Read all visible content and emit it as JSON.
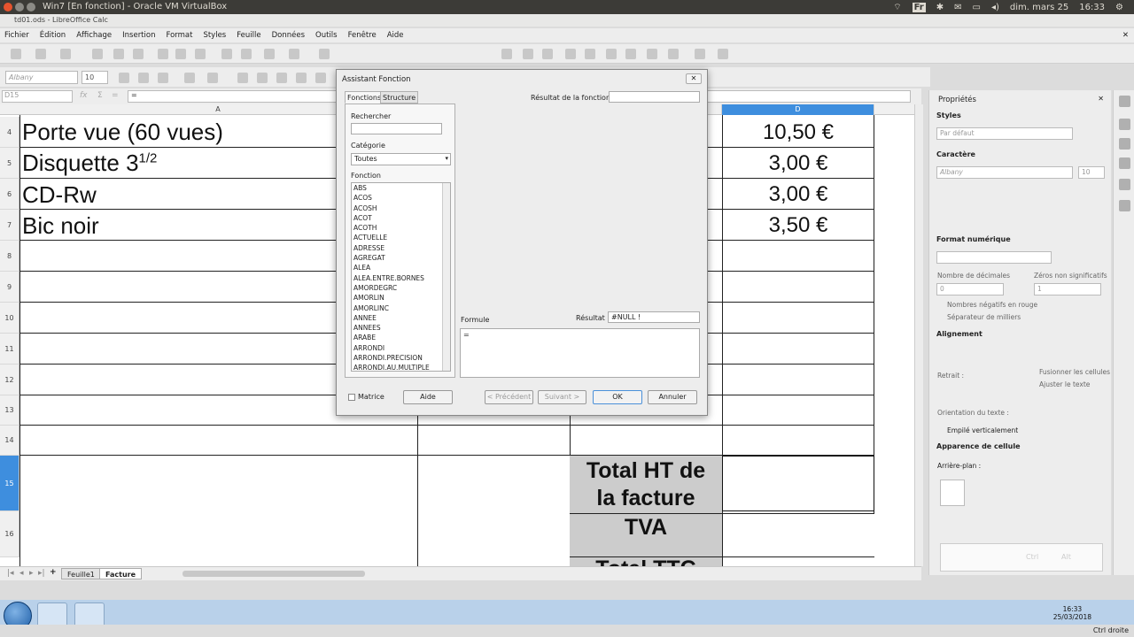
{
  "os": {
    "title": "Win7 [En fonction] - Oracle VM VirtualBox",
    "lang": "Fr",
    "datetime": "dim. mars 25",
    "time": "16:33"
  },
  "app": {
    "title": "td01.ods - LibreOffice Calc"
  },
  "menu": [
    "Fichier",
    "Édition",
    "Affichage",
    "Insertion",
    "Format",
    "Styles",
    "Feuille",
    "Données",
    "Outils",
    "Fenêtre",
    "Aide"
  ],
  "toolbar": {
    "font_name": "Albany",
    "font_size": "10"
  },
  "formula_bar": {
    "name_box": "D15",
    "fx": "fx",
    "sum": "Σ",
    "eq": "=",
    "content": "="
  },
  "columns": [
    {
      "label": "A"
    },
    {
      "label": "D"
    }
  ],
  "rows": {
    "labels": [
      "4",
      "5",
      "6",
      "7",
      "8",
      "9",
      "10",
      "11",
      "12",
      "13",
      "14",
      "15",
      "16"
    ]
  },
  "cells": {
    "a4": "Porte vue (60 vues)",
    "a5": "Disquette 3",
    "a5_sup": "1/2",
    "a6": "CD-Rw",
    "a7": "Bic noir",
    "d4": "10,50 €",
    "d5": "3,00 €",
    "d6": "3,00 €",
    "d7": "3,50 €",
    "c15_line1": "Total HT de",
    "c15_line2": "la facture",
    "c16": "TVA",
    "c17": "Total TTC"
  },
  "sheets": {
    "tabs": [
      "Feuille1",
      "Facture"
    ],
    "active": "Facture",
    "add": "+"
  },
  "dialog": {
    "title": "Assistant Fonction",
    "close": "✕",
    "tabs": [
      "Fonctions",
      "Structure"
    ],
    "search_label": "Rechercher",
    "search_value": "",
    "category_label": "Catégorie",
    "category_value": "Toutes",
    "function_label": "Fonction",
    "functions": [
      "ABS",
      "ACOS",
      "ACOSH",
      "ACOT",
      "ACOTH",
      "ACTUELLE",
      "ADRESSE",
      "AGREGAT",
      "ALEA",
      "ALEA.ENTRE.BORNES",
      "AMORDEGRC",
      "AMORLIN",
      "AMORLINC",
      "ANNEE",
      "ANNEES",
      "ARABE",
      "ARRONDI",
      "ARRONDI.PRECISION",
      "ARRONDI.AU.MULTIPLE"
    ],
    "result_fn_label": "Résultat de la fonction",
    "result_fn_value": "",
    "formula_label": "Formule",
    "result_label": "Résultat",
    "result_value": "#NULL !",
    "formula_value": "=",
    "matrix_label": "Matrice",
    "help": "Aide",
    "prev": "< Précédent",
    "next": "Suivant >",
    "ok": "OK",
    "cancel": "Annuler"
  },
  "sidebar": {
    "title": "Propriétés",
    "close": "✕",
    "styles_section": "Styles",
    "style_value": "Par défaut",
    "char_section": "Caractère",
    "font_value": "Albany",
    "size_value": "10",
    "numfmt_section": "Format numérique",
    "decimals_label": "Nombre de décimales",
    "decimals_value": "0",
    "zeros_label": "Zéros non significatifs",
    "zeros_value": "1",
    "neg_red": "Nombres négatifs en rouge",
    "thousands": "Séparateur de milliers",
    "align_section": "Alignement",
    "indent_label": "Retrait :",
    "merge": "Fusionner les cellules",
    "wrap": "Ajuster le texte",
    "orient_label": "Orientation du texte :",
    "stacked": "Empilé verticalement",
    "appearance_section": "Apparence de cellule",
    "bg_label": "Arrière-plan :",
    "key_ctrl": "Ctrl",
    "key_alt": "Alt"
  },
  "taskbar": {
    "time": "16:33",
    "date": "25/03/2018"
  },
  "vbox": {
    "host_key": "Ctrl droite"
  }
}
